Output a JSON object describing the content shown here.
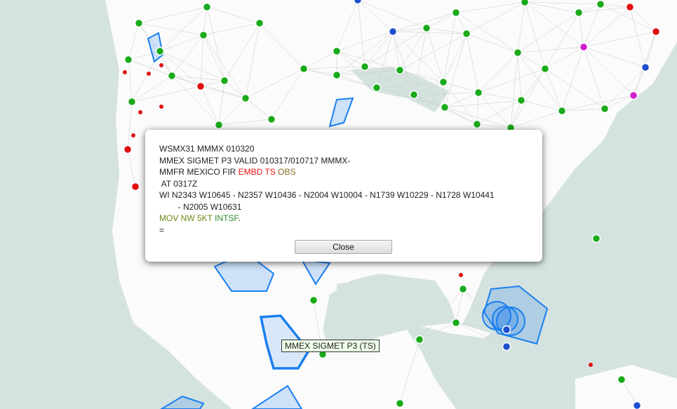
{
  "dialog": {
    "lines": {
      "l1": "WSMX31 MMMX 010320",
      "l2": "MMEX SIGMET P3 VALID 010317/010717 MMMX-",
      "l3_prefix": "MMFR MEXICO FIR ",
      "l3_hazard1": "EMBD",
      "l3_hazard2": "TS",
      "l3_obs": "OBS",
      "l4": " AT 0317Z",
      "l5": "WI N2343 W10645 - N2357 W10436 - N2004 W10004 - N1739 W10229 - N1728 W10441",
      "l6": "        - N2005 W10631",
      "l7_mov": "MOV NW 5KT",
      "l7_int": "INTSF",
      "l7_end": ".",
      "l8": "="
    },
    "close_label": "Close"
  },
  "tooltip": "MMEX SIGMET P3 (TS)",
  "colors": {
    "water": "#d5e3e0",
    "land": "#fbfbfb",
    "sigmet": "#1a7ff0",
    "station_vfr": "#1aaa1a",
    "station_ifr": "#e01010",
    "station_mvfr": "#1f4fd0",
    "station_lifr": "#d020d0"
  }
}
